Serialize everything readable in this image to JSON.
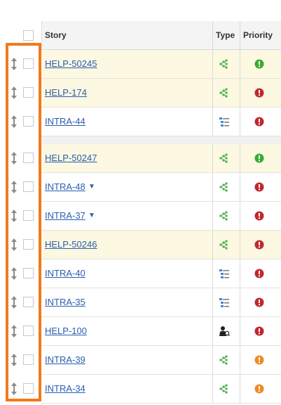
{
  "table": {
    "columns": {
      "story": "Story",
      "type": "Type",
      "priority": "Priority"
    },
    "colors": {
      "row_highlight": "#fcf8e1",
      "link": "#2a5db0",
      "priority_green": "#3aaa35",
      "priority_red": "#c0282d",
      "priority_orange": "#f08a24",
      "type_green": "#4caf50",
      "type_blue": "#4a87c7",
      "selection_outline": "#f27a1a"
    },
    "rows": [
      {
        "story": "HELP-50245",
        "type_icon": "story-branch-icon",
        "priority_icon": "priority-green-icon",
        "highlighted": true,
        "caret": ""
      },
      {
        "story": "HELP-174",
        "type_icon": "story-branch-icon",
        "priority_icon": "priority-red-icon",
        "highlighted": true,
        "caret": ""
      },
      {
        "story": "INTRA-44",
        "type_icon": "checklist-icon",
        "priority_icon": "priority-red-icon",
        "highlighted": false,
        "caret": ""
      },
      {
        "story": "HELP-50247",
        "type_icon": "story-branch-icon",
        "priority_icon": "priority-green-icon",
        "highlighted": true,
        "caret": ""
      },
      {
        "story": "INTRA-48",
        "type_icon": "story-branch-icon",
        "priority_icon": "priority-red-icon",
        "highlighted": false,
        "caret": "▼"
      },
      {
        "story": "INTRA-37",
        "type_icon": "story-branch-icon",
        "priority_icon": "priority-red-icon",
        "highlighted": false,
        "caret": "▼"
      },
      {
        "story": "HELP-50246",
        "type_icon": "story-branch-icon",
        "priority_icon": "priority-red-icon",
        "highlighted": true,
        "caret": ""
      },
      {
        "story": "INTRA-40",
        "type_icon": "checklist-icon",
        "priority_icon": "priority-red-icon",
        "highlighted": false,
        "caret": ""
      },
      {
        "story": "INTRA-35",
        "type_icon": "checklist-icon",
        "priority_icon": "priority-red-icon",
        "highlighted": false,
        "caret": ""
      },
      {
        "story": "HELP-100",
        "type_icon": "support-person-icon",
        "priority_icon": "priority-red-icon",
        "highlighted": false,
        "caret": ""
      },
      {
        "story": "INTRA-39",
        "type_icon": "story-branch-icon",
        "priority_icon": "priority-orange-icon",
        "highlighted": false,
        "caret": ""
      },
      {
        "story": "INTRA-34",
        "type_icon": "story-branch-icon",
        "priority_icon": "priority-orange-icon",
        "highlighted": false,
        "caret": ""
      }
    ],
    "priority_glyph": "!"
  }
}
